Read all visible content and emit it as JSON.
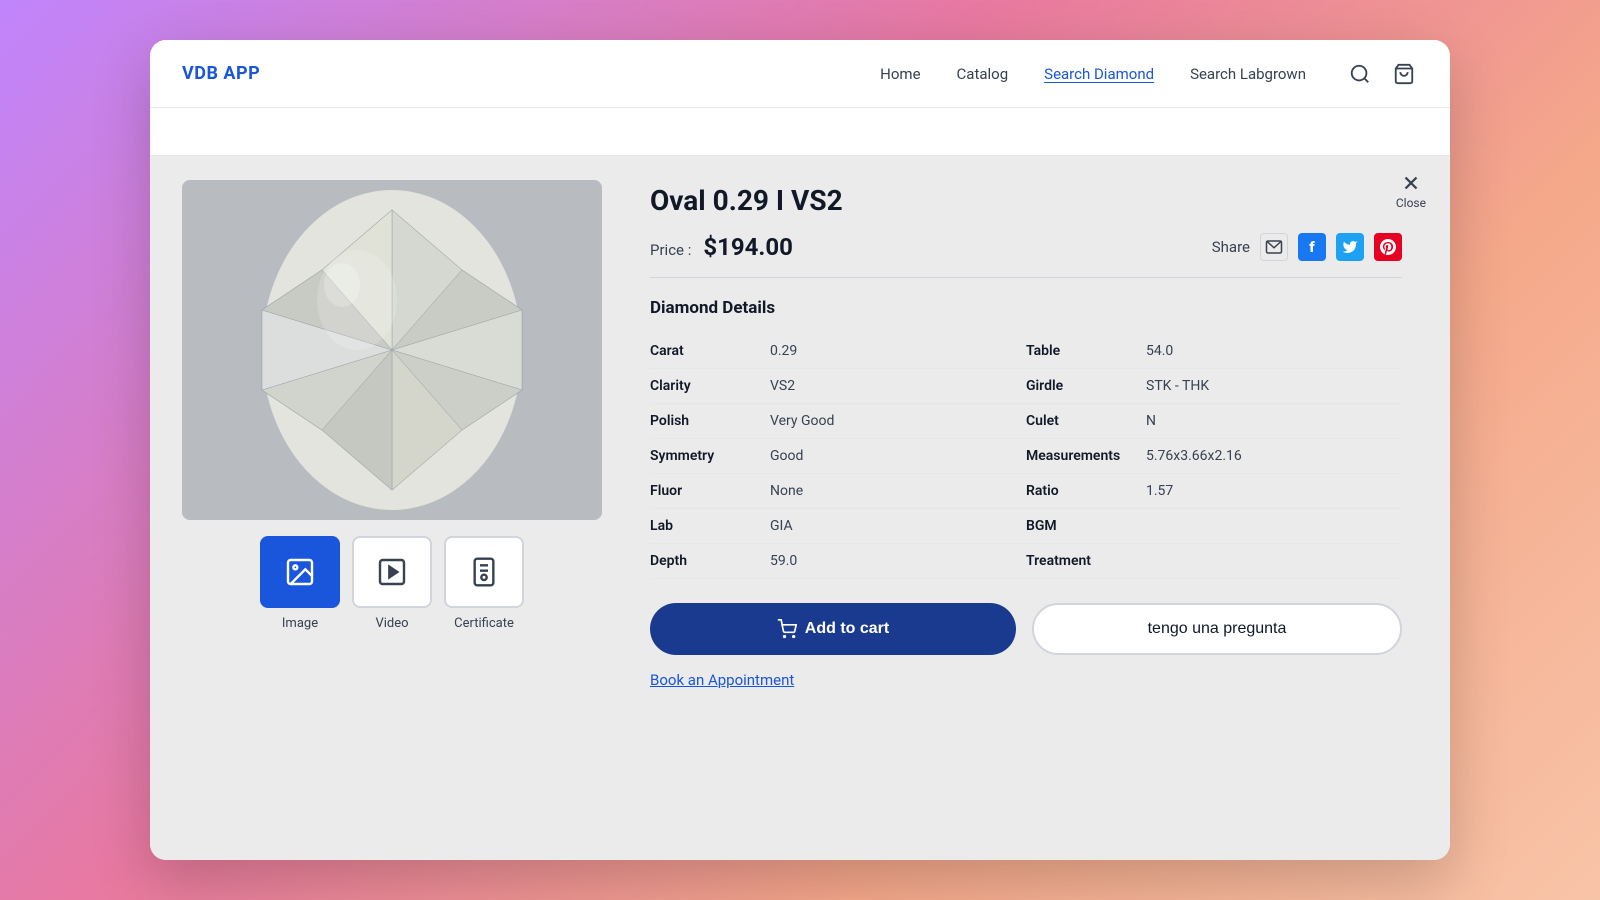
{
  "app": {
    "logo": "VDB APP",
    "nav": [
      {
        "label": "Home",
        "active": false
      },
      {
        "label": "Catalog",
        "active": false
      },
      {
        "label": "Search Diamond",
        "active": true
      },
      {
        "label": "Search Labgrown",
        "active": false
      }
    ],
    "close_label": "Close"
  },
  "diamond": {
    "title": "Oval 0.29 I VS2",
    "price_label": "Price :",
    "price": "$194.00",
    "share_label": "Share",
    "details_title": "Diamond Details",
    "details_left": [
      {
        "label": "Carat",
        "value": "0.29"
      },
      {
        "label": "Clarity",
        "value": "VS2"
      },
      {
        "label": "Polish",
        "value": "Very Good"
      },
      {
        "label": "Symmetry",
        "value": "Good"
      },
      {
        "label": "Fluor",
        "value": "None"
      },
      {
        "label": "Lab",
        "value": "GIA"
      },
      {
        "label": "Depth",
        "value": "59.0"
      }
    ],
    "details_right": [
      {
        "label": "Table",
        "value": "54.0"
      },
      {
        "label": "Girdle",
        "value": "STK - THK"
      },
      {
        "label": "Culet",
        "value": "N"
      },
      {
        "label": "Measurements",
        "value": "5.76x3.66x2.16"
      },
      {
        "label": "Ratio",
        "value": "1.57"
      },
      {
        "label": "BGM",
        "value": ""
      },
      {
        "label": "Treatment",
        "value": ""
      }
    ]
  },
  "media_tabs": [
    {
      "label": "Image",
      "active": true
    },
    {
      "label": "Video",
      "active": false
    },
    {
      "label": "Certificate",
      "active": false
    }
  ],
  "buttons": {
    "add_to_cart": "Add to cart",
    "question": "tengo una pregunta",
    "appointment": "Book an Appointment"
  }
}
